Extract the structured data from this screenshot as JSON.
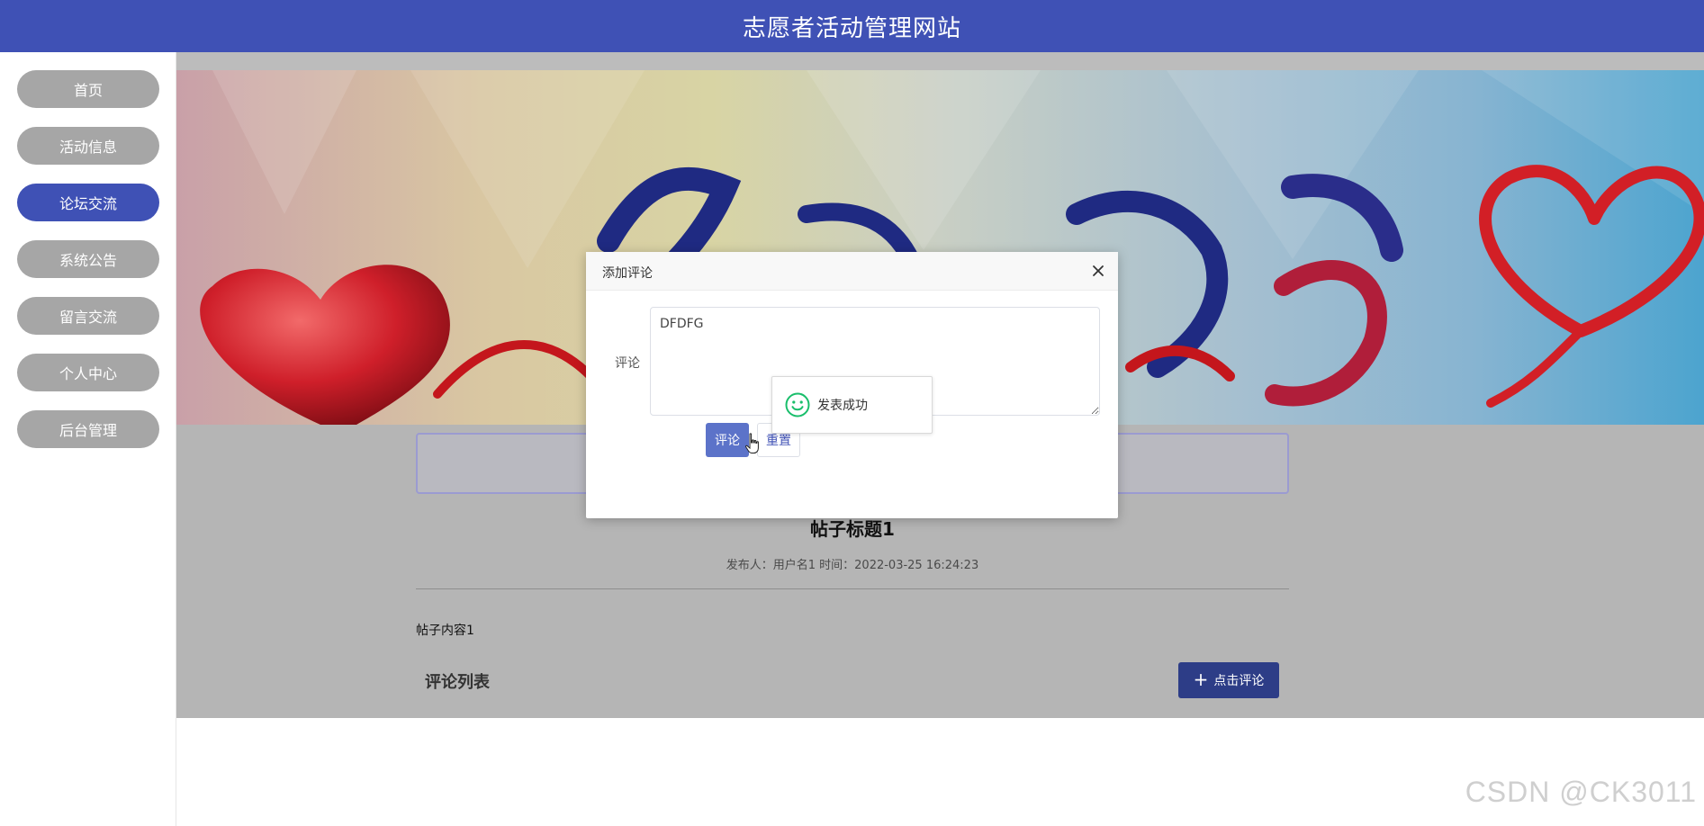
{
  "header": {
    "title": "志愿者活动管理网站"
  },
  "sidebar": {
    "items": [
      {
        "label": "首页",
        "active": false
      },
      {
        "label": "活动信息",
        "active": false
      },
      {
        "label": "论坛交流",
        "active": true
      },
      {
        "label": "系统公告",
        "active": false
      },
      {
        "label": "留言交流",
        "active": false
      },
      {
        "label": "个人中心",
        "active": false
      },
      {
        "label": "后台管理",
        "active": false
      }
    ]
  },
  "post": {
    "title": "帖子标题1",
    "meta": "发布人：用户名1 时间：2022-03-25 16:24:23",
    "content": "帖子内容1"
  },
  "comments": {
    "list_title": "评论列表",
    "add_button_label": "点击评论"
  },
  "dialog": {
    "title": "添加评论",
    "field_label": "评论",
    "textarea_value": "DFDFG",
    "submit_label": "评论",
    "reset_label": "重置"
  },
  "toast": {
    "message": "发表成功"
  },
  "watermark": "CSDN @CK3011",
  "colors": {
    "primary": "#3f51b5",
    "nav_inactive": "#a6a6a6",
    "success": "#19be6b"
  }
}
